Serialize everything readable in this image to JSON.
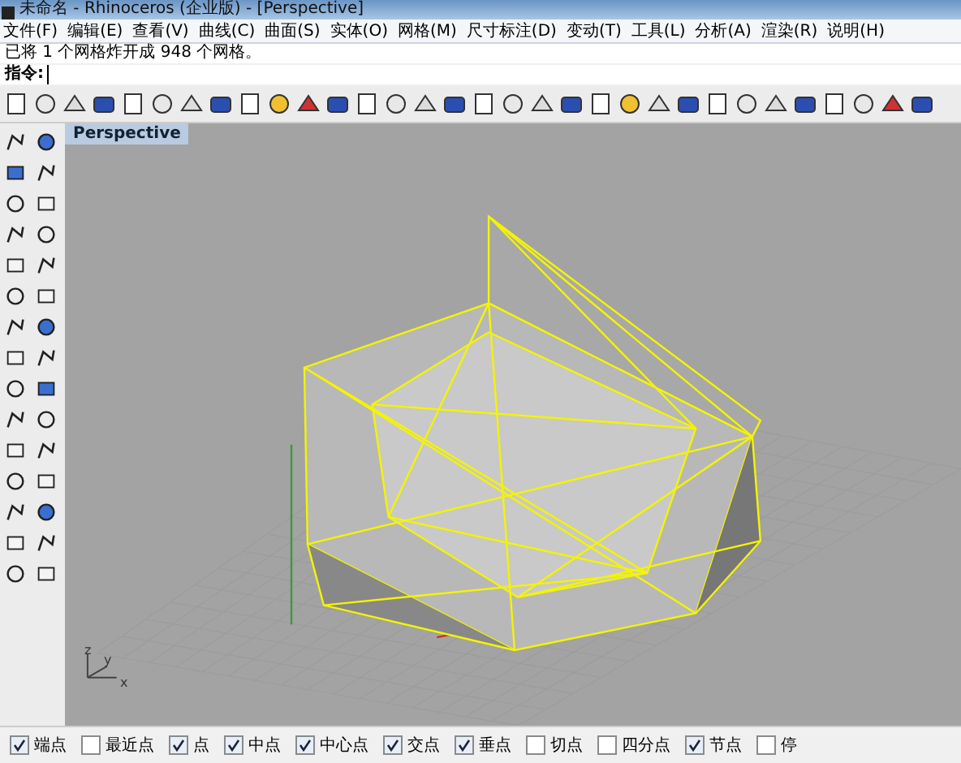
{
  "window": {
    "title": "未命名 - Rhinoceros (企业版) - [Perspective]"
  },
  "menu": [
    "文件(F)",
    "编辑(E)",
    "查看(V)",
    "曲线(C)",
    "曲面(S)",
    "实体(O)",
    "网格(M)",
    "尺寸标注(D)",
    "变动(T)",
    "工具(L)",
    "分析(A)",
    "渲染(R)",
    "说明(H)"
  ],
  "command_history": "已将 1 个网格炸开成 948 个网格。",
  "command_prompt": {
    "label": "指令:"
  },
  "viewport": {
    "tab": "Perspective",
    "axis_labels": [
      "z",
      "y",
      "x"
    ]
  },
  "osnaps": [
    {
      "label": "端点",
      "checked": true
    },
    {
      "label": "最近点",
      "checked": false
    },
    {
      "label": "点",
      "checked": true
    },
    {
      "label": "中点",
      "checked": true
    },
    {
      "label": "中心点",
      "checked": true
    },
    {
      "label": "交点",
      "checked": true
    },
    {
      "label": "垂点",
      "checked": true
    },
    {
      "label": "切点",
      "checked": false
    },
    {
      "label": "四分点",
      "checked": false
    },
    {
      "label": "节点",
      "checked": true
    },
    {
      "label": "停",
      "checked": false
    }
  ]
}
